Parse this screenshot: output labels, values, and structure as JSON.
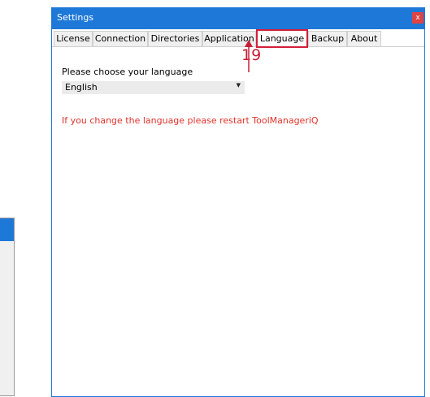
{
  "window": {
    "title": "Settings",
    "close_icon": "close-icon",
    "close_glyph": "x"
  },
  "tabs": [
    {
      "label": "License"
    },
    {
      "label": "Connection"
    },
    {
      "label": "Directories"
    },
    {
      "label": "Application"
    },
    {
      "label": "Language",
      "active": true
    },
    {
      "label": "Backup"
    },
    {
      "label": "About"
    }
  ],
  "language_panel": {
    "prompt": "Please choose your language",
    "selected_language": "English",
    "dropdown_icon": "chevron-down-icon",
    "restart_warning": "If you change the language please restart ToolManageriQ"
  },
  "callout": {
    "number": "19",
    "color": "#c81d35"
  },
  "colors": {
    "titlebar": "#1e78d7",
    "close_button": "#e04343",
    "warning_text": "#e0332b",
    "active_tab_border": "#d31f3a"
  }
}
